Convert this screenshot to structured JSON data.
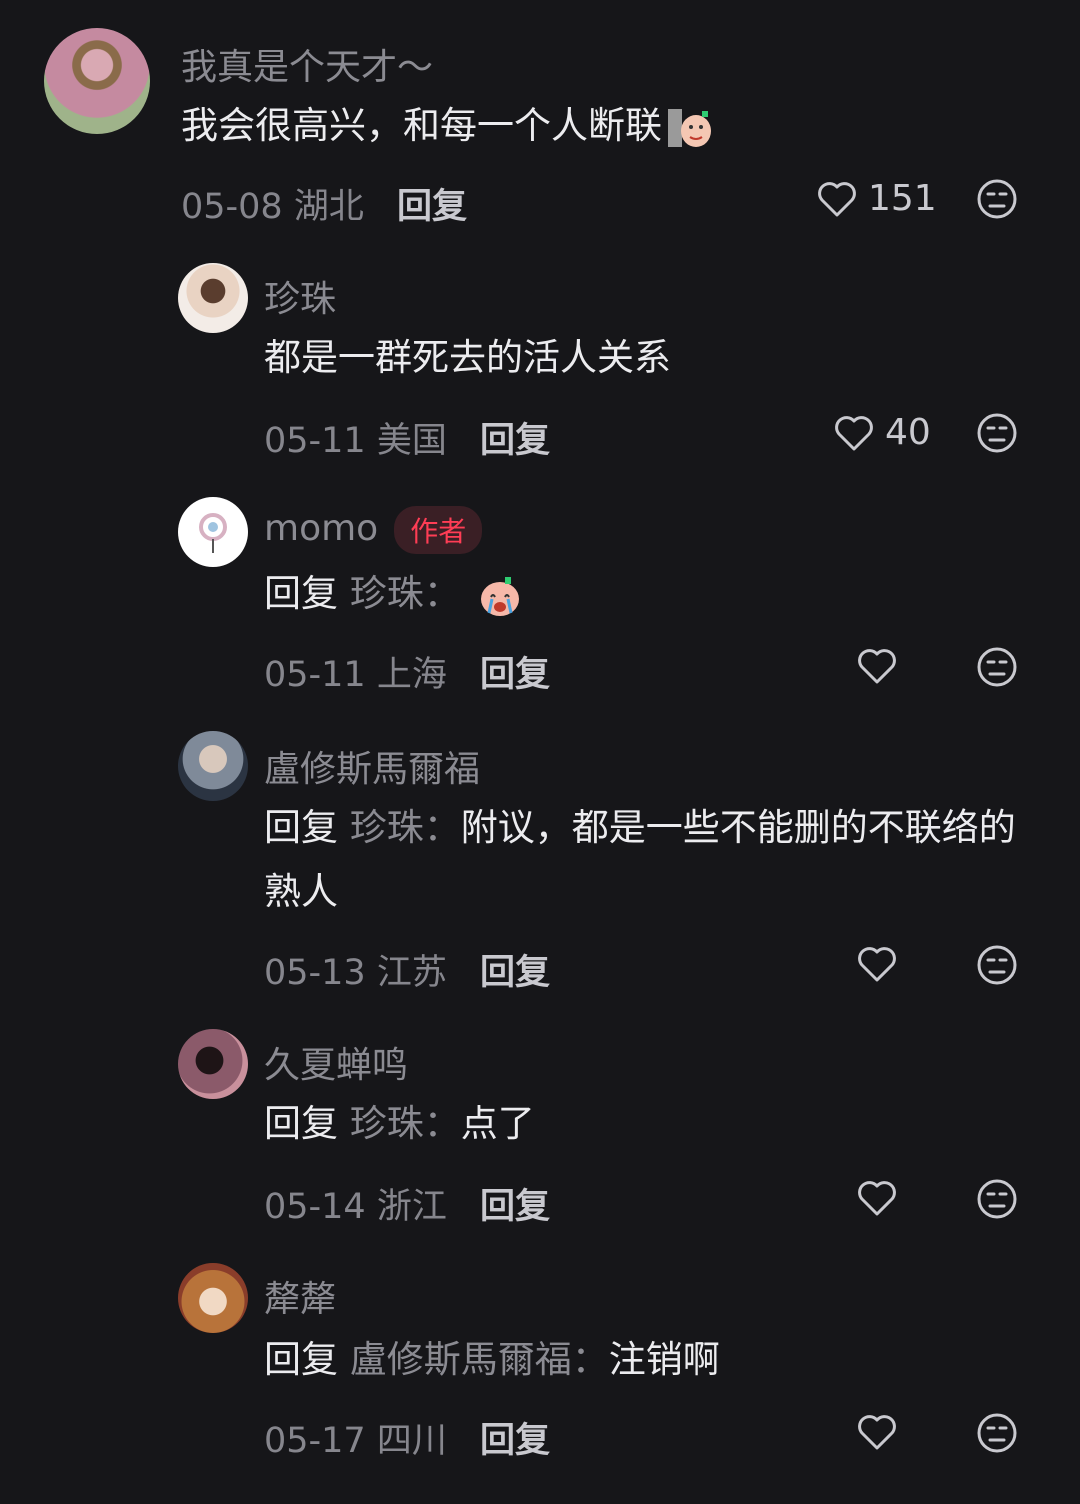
{
  "comments": [
    {
      "user": "我真是个天才～",
      "text": "我会很高兴，和每一个人断联",
      "date": "05-08",
      "location": "湖北",
      "reply": "回复",
      "likes": "151"
    },
    {
      "user": "珍珠",
      "text": "都是一群死去的活人关系",
      "date": "05-11",
      "location": "美国",
      "reply": "回复",
      "likes": "40"
    },
    {
      "user": "momo",
      "badge": "作者",
      "reply_prefix": "回复",
      "reply_target": "珍珠：",
      "text": "",
      "date": "05-11",
      "location": "上海",
      "reply": "回复"
    },
    {
      "user": "盧修斯馬爾福",
      "reply_prefix": "回复",
      "reply_target": "珍珠：",
      "text": "附议，都是一些不能删的不联络的熟人",
      "date": "05-13",
      "location": "江苏",
      "reply": "回复"
    },
    {
      "user": "久夏蝉鸣",
      "reply_prefix": "回复",
      "reply_target": "珍珠：",
      "text": "点了",
      "date": "05-14",
      "location": "浙江",
      "reply": "回复"
    },
    {
      "user": "犛犛",
      "reply_prefix": "回复",
      "reply_target": "盧修斯馬爾福：",
      "text": "注销啊",
      "date": "05-17",
      "location": "四川",
      "reply": "回复"
    }
  ],
  "icons": {
    "like": "heart-outline-icon",
    "dislike": "meh-face-icon"
  },
  "colors": {
    "background": "#161619",
    "text_primary": "#ececef",
    "text_secondary": "#8b8b92",
    "author_badge": "#ff3d55"
  }
}
